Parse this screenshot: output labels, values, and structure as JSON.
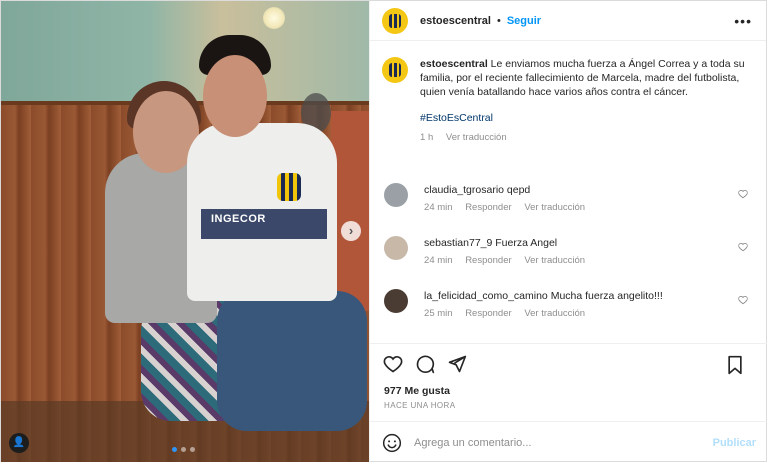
{
  "post": {
    "username": "estoescentral",
    "separator": "•",
    "follow_label": "Seguir",
    "more_label": "•••",
    "sponsor_text": "INGECOR"
  },
  "caption": {
    "username": "estoescentral",
    "text": " Le enviamos mucha fuerza a Ángel Correa y a toda su familia, por el reciente fallecimiento de Marcela, madre del futbolista, quien venía batallando hace varios años contra el cáncer.",
    "hashtag": "#EstoEsCentral",
    "time": "1 h",
    "translate_label": "Ver traducción"
  },
  "comments": [
    {
      "username": "claudia_tgrosario",
      "text": " qepd",
      "time": "24 min",
      "reply_label": "Responder",
      "translate_label": "Ver traducción",
      "avatar_color": "#9aa0a6"
    },
    {
      "username": "sebastian77_9",
      "text": " Fuerza Angel",
      "time": "24 min",
      "reply_label": "Responder",
      "translate_label": "Ver traducción",
      "avatar_color": "#c7b8a8"
    },
    {
      "username": "la_felicidad_como_camino",
      "text": " Mucha fuerza angelito!!!",
      "time": "25 min",
      "reply_label": "Responder",
      "translate_label": "Ver traducción",
      "avatar_color": "#4a3b33"
    }
  ],
  "stats": {
    "likes": "977 Me gusta",
    "posted": "HACE UNA HORA"
  },
  "add_comment": {
    "placeholder": "Agrega un comentario...",
    "publish_label": "Publicar"
  },
  "carousel": {
    "next_label": "›",
    "user_tag_label": "👤",
    "current_slide": 1,
    "slide_count": 3
  },
  "colors": {
    "accent": "#0095f6",
    "hashtag": "#00376b",
    "muted": "#8e8e8e",
    "publish_disabled": "#b2dffc",
    "brand_yellow": "#f3c713"
  },
  "icons": [
    "heart-icon",
    "comment-icon",
    "share-icon",
    "bookmark-icon",
    "emoji-icon",
    "more-icon",
    "next-icon",
    "user-tag-icon"
  ]
}
